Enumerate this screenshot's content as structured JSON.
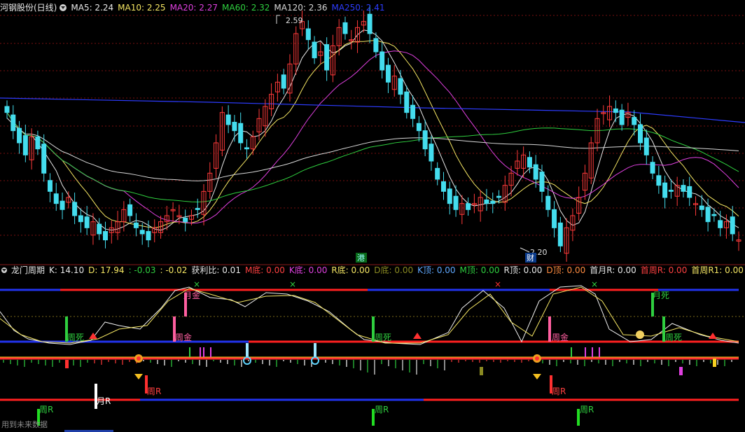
{
  "main_header": {
    "title": "河钢股份(日线)",
    "items": [
      {
        "label": "MA5: 2.24",
        "color": "#e8e8e8"
      },
      {
        "label": "MA10: 2.25",
        "color": "#f5e663"
      },
      {
        "label": "MA20: 2.27",
        "color": "#e040e0"
      },
      {
        "label": "MA60: 2.32",
        "color": "#2fcf3f"
      },
      {
        "label": "MA120: 2.36",
        "color": "#d8d8d8"
      },
      {
        "label": "MA250: 2.41",
        "color": "#2d3cff"
      }
    ]
  },
  "price_labels": {
    "high": "2.59",
    "low": "2.20",
    "gang": "港",
    "cai": "财"
  },
  "indicator_header": {
    "title": "龙门周期",
    "items": [
      {
        "label": "K: 14.10",
        "color": "#e8e8e8"
      },
      {
        "label": "D: 17.94",
        "color": "#f5e663"
      },
      {
        "label": ": -0.03",
        "color": "#2fcf3f"
      },
      {
        "label": ": -0.02",
        "color": "#f5e663"
      },
      {
        "label": "获利比: 0.01",
        "color": "#e8e8e8"
      },
      {
        "label": "M底: 0.00",
        "color": "#ff4040"
      },
      {
        "label": "K底: 0.00",
        "color": "#e040e0"
      },
      {
        "label": "R底: 0.00",
        "color": "#f5e663"
      },
      {
        "label": "D底: 0.00",
        "color": "#8a8a22"
      },
      {
        "label": "K顶: 0.00",
        "color": "#5fa8ff"
      },
      {
        "label": "M顶: 0.00",
        "color": "#2fcf3f"
      },
      {
        "label": "R顶: 0.00",
        "color": "#e8e8e8"
      },
      {
        "label": "D顶: 0.00",
        "color": "#ff8c40"
      },
      {
        "label": "首月R: 0.00",
        "color": "#e8e8e8"
      },
      {
        "label": "首周R: 0.00",
        "color": "#ff4040"
      },
      {
        "label": "首周R1: 0.00",
        "color": "#f5e663"
      }
    ]
  },
  "indicator_labels": {
    "yue_jin": "月金",
    "zhou_si": "周死",
    "zhou_jin": "周金",
    "yue_si": "月死",
    "zhou_r": "周R",
    "yue_r": "月R"
  },
  "footer": {
    "text": "用到未来数据"
  },
  "colors": {
    "up": "#ff3a3a",
    "down": "#44ddee",
    "grid": "#7a1010",
    "bg": "#000000"
  }
}
